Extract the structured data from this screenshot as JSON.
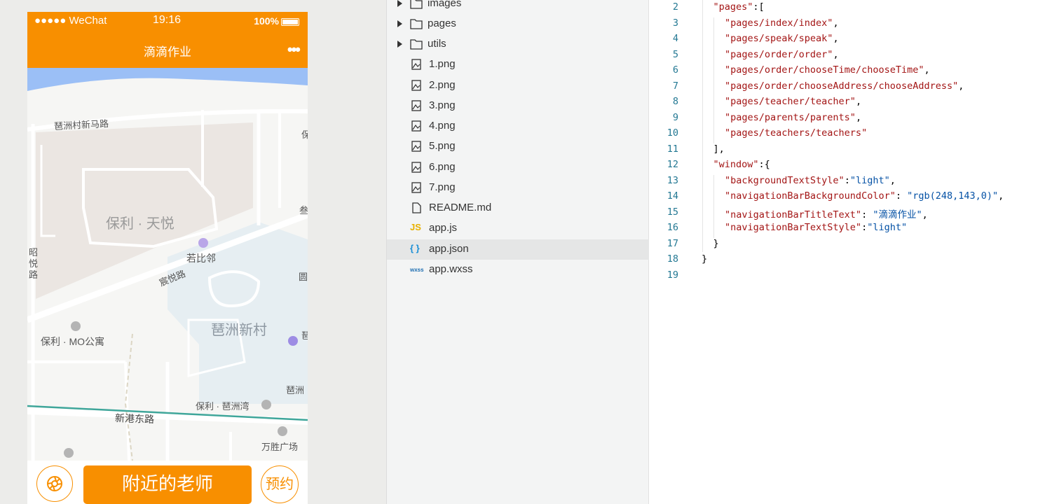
{
  "simulator": {
    "status_bar": {
      "carrier": "●●●●● WeChat",
      "time": "19:16",
      "battery": "100%"
    },
    "nav_bar": {
      "title": "滴滴作业",
      "more": "•••"
    },
    "map": {
      "labels": {
        "road_1": "琶洲村新马路",
        "area_1": "保利 · 天悦",
        "poi_1": "若比邻",
        "road_2": "宸悦路",
        "road_3": "昭\n悦\n路",
        "area_2": "琶洲新村",
        "poi_2": "保利 · MO公寓",
        "poi_3": "保利 · 琶洲湾",
        "road_4": "新港东路",
        "poi_4": "万胜广场",
        "edge_1": "保",
        "edge_2": "叁",
        "edge_3": "琶",
        "edge_4": "琶洲",
        "edge_5": "圆"
      },
      "colors": {
        "water": "#9bbff6",
        "road": "#ffffff",
        "block": "#ebe6e2",
        "residential": "#e6eef2",
        "metro": "#3fa69a"
      }
    },
    "bottom_bar": {
      "locate_icon": "camera-aperture-icon",
      "nearby_label": "附近的老师",
      "book_label": "预约"
    },
    "accent": "#f88f00"
  },
  "file_tree": {
    "items": [
      {
        "name": "images",
        "type": "folder"
      },
      {
        "name": "pages",
        "type": "folder"
      },
      {
        "name": "utils",
        "type": "folder"
      },
      {
        "name": "1.png",
        "type": "image"
      },
      {
        "name": "2.png",
        "type": "image"
      },
      {
        "name": "3.png",
        "type": "image"
      },
      {
        "name": "4.png",
        "type": "image"
      },
      {
        "name": "5.png",
        "type": "image"
      },
      {
        "name": "6.png",
        "type": "image"
      },
      {
        "name": "7.png",
        "type": "image"
      },
      {
        "name": "README.md",
        "type": "file"
      },
      {
        "name": "app.js",
        "type": "js",
        "badge": "JS"
      },
      {
        "name": "app.json",
        "type": "json",
        "badge": "{ }",
        "selected": true
      },
      {
        "name": "app.wxss",
        "type": "wxss",
        "badge": "wxss"
      }
    ]
  },
  "editor": {
    "lines": [
      {
        "n": "2",
        "indent": 1,
        "parts": [
          [
            "str",
            "\"pages\""
          ],
          [
            "p",
            ":["
          ]
        ]
      },
      {
        "n": "3",
        "indent": 2,
        "parts": [
          [
            "str",
            "\"pages/index/index\""
          ],
          [
            "p",
            ","
          ]
        ]
      },
      {
        "n": "4",
        "indent": 2,
        "parts": [
          [
            "str",
            "\"pages/speak/speak\""
          ],
          [
            "p",
            ","
          ]
        ]
      },
      {
        "n": "5",
        "indent": 2,
        "parts": [
          [
            "str",
            "\"pages/order/order\""
          ],
          [
            "p",
            ","
          ]
        ]
      },
      {
        "n": "6",
        "indent": 2,
        "parts": [
          [
            "str",
            "\"pages/order/chooseTime/chooseTime\""
          ],
          [
            "p",
            ","
          ]
        ]
      },
      {
        "n": "7",
        "indent": 2,
        "parts": [
          [
            "str",
            "\"pages/order/chooseAddress/chooseAddress\""
          ],
          [
            "p",
            ","
          ]
        ]
      },
      {
        "n": "8",
        "indent": 2,
        "parts": [
          [
            "str",
            "\"pages/teacher/teacher\""
          ],
          [
            "p",
            ","
          ]
        ]
      },
      {
        "n": "9",
        "indent": 2,
        "parts": [
          [
            "str",
            "\"pages/parents/parents\""
          ],
          [
            "p",
            ","
          ]
        ]
      },
      {
        "n": "10",
        "indent": 2,
        "parts": [
          [
            "str",
            "\"pages/teachers/teachers\""
          ]
        ]
      },
      {
        "n": "11",
        "indent": 1,
        "parts": [
          [
            "p",
            "],"
          ]
        ]
      },
      {
        "n": "12",
        "indent": 1,
        "parts": [
          [
            "str",
            "\"window\""
          ],
          [
            "p",
            ":{"
          ]
        ]
      },
      {
        "n": "13",
        "indent": 2,
        "parts": [
          [
            "str",
            "\"backgroundTextStyle\""
          ],
          [
            "p",
            ":"
          ],
          [
            "val",
            "\"light\""
          ],
          [
            "p",
            ","
          ]
        ]
      },
      {
        "n": "14",
        "indent": 2,
        "parts": [
          [
            "str",
            "\"navigationBarBackgroundColor\""
          ],
          [
            "p",
            ": "
          ],
          [
            "val",
            "\"rgb(248,143,0)\""
          ],
          [
            "p",
            ","
          ]
        ]
      },
      {
        "n": "15",
        "indent": 2,
        "parts": [
          [
            "str",
            "\"navigationBarTitleText\""
          ],
          [
            "p",
            ": "
          ],
          [
            "val",
            "\"滴滴作业\""
          ],
          [
            "p",
            ","
          ]
        ]
      },
      {
        "n": "16",
        "indent": 2,
        "parts": [
          [
            "str",
            "\"navigationBarTextStyle\""
          ],
          [
            "p",
            ":"
          ],
          [
            "val",
            "\"light\""
          ]
        ]
      },
      {
        "n": "17",
        "indent": 1,
        "parts": [
          [
            "p",
            "}"
          ]
        ]
      },
      {
        "n": "18",
        "indent": 0,
        "parts": [
          [
            "p",
            "}"
          ]
        ]
      },
      {
        "n": "19",
        "indent": 0,
        "parts": []
      }
    ]
  }
}
